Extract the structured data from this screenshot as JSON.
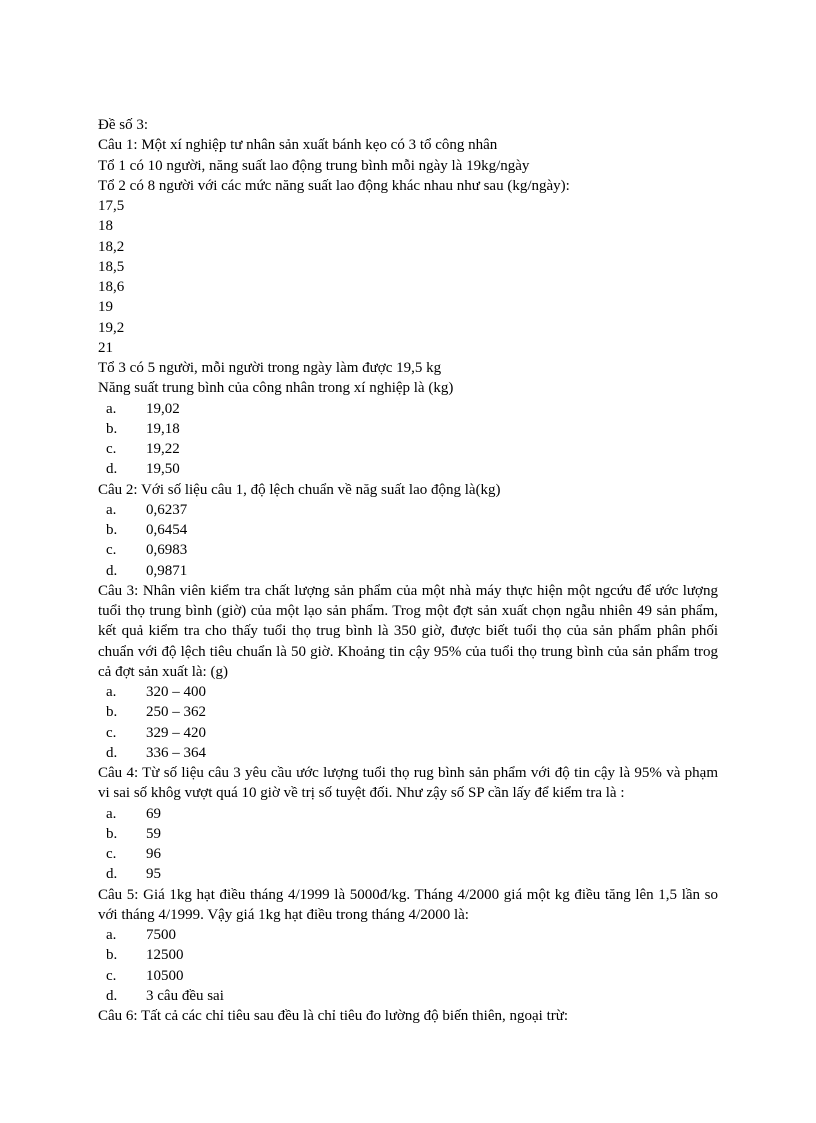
{
  "title": "Đề số 3:",
  "q1": {
    "line1": "Câu 1: Một xí nghiệp tư nhân sản xuất bánh kẹo có 3 tổ công nhân",
    "line2": "Tổ 1 có 10 người, năng suất lao động trung bình mỗi ngày là 19kg/ngày",
    "line3": "Tổ 2 có 8 người với các mức năng suất lao động khác nhau như sau (kg/ngày):",
    "values": [
      "17,5",
      "18",
      "18,2",
      "18,5",
      "18,6",
      "19",
      "19,2",
      "21"
    ],
    "line4": "Tổ 3 có 5 người, mỗi người trong ngày làm được 19,5 kg",
    "line5": "Năng suất trung bình của công nhân trong xí nghiệp là (kg)",
    "options": {
      "a": "19,02",
      "b": "19,18",
      "c": "19,22",
      "d": "19,50"
    }
  },
  "q2": {
    "text": "Câu 2: Với số liệu câu 1, độ lệch chuẩn về năg suất lao động là(kg)",
    "options": {
      "a": "0,6237",
      "b": "0,6454",
      "c": "0,6983",
      "d": "0,9871"
    }
  },
  "q3": {
    "text": "Câu 3: Nhân viên kiểm tra chất lượng sản phẩm của một nhà máy thực hiện một ngcứu để ước lượng tuổi thọ trung bình (giờ) của một lạo sản phẩm. Trog một đợt sản xuất chọn ngẫu nhiên 49 sản phẩm, kết quả kiểm tra cho thấy tuổi thọ trug bình là 350 giờ, được biết tuổi thọ của sản phẩm phân phối chuẩn với độ lệch tiêu chuẩn là 50 giờ. Khoảng tin cậy 95% của tuổi thọ trung bình của sản phẩm trog cả đợt sản xuất là: (g)",
    "options": {
      "a": "320 – 400",
      "b": "250 – 362",
      "c": "329 – 420",
      "d": "336 – 364"
    }
  },
  "q4": {
    "text": "Câu 4: Từ số liệu câu 3 yêu cầu ước lượng tuổi thọ rug bình sản phẩm với độ tin cậy là 95% và phạm vi sai số khôg vượt quá 10 giờ về trị số tuyệt đối. Như zậy số SP cần lấy để kiểm tra là :",
    "options": {
      "a": "69",
      "b": "59",
      "c": "96",
      "d": "95"
    }
  },
  "q5": {
    "text": "Câu 5: Giá 1kg hạt điều tháng 4/1999 là 5000đ/kg. Tháng 4/2000 giá một kg điều tăng lên 1,5 lần so với tháng 4/1999. Vậy giá 1kg hạt điều trong tháng 4/2000 là:",
    "options": {
      "a": "7500",
      "b": "12500",
      "c": "10500",
      "d": "3 câu đều sai"
    }
  },
  "q6": {
    "text": "Câu 6: Tất cả các chỉ tiêu sau đều là chỉ tiêu đo lường độ biến thiên, ngoại trừ:"
  },
  "labels": {
    "a": "a.",
    "b": "b.",
    "c": "c.",
    "d": "d."
  }
}
